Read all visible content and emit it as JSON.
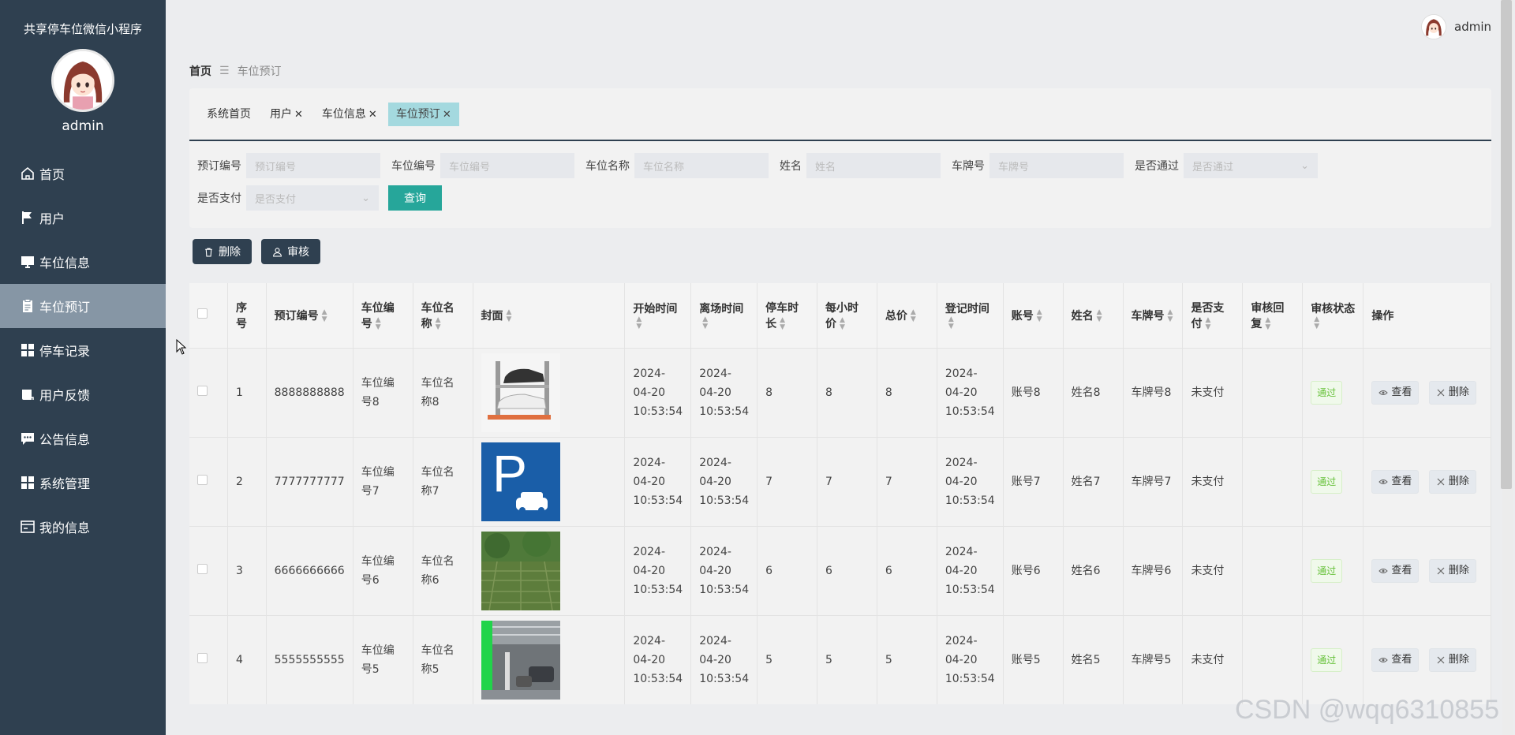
{
  "app": {
    "title": "共享停车位微信小程序",
    "user": "admin"
  },
  "sidebar": {
    "items": [
      {
        "label": "首页",
        "icon": "home-icon"
      },
      {
        "label": "用户",
        "icon": "flag-icon"
      },
      {
        "label": "车位信息",
        "icon": "monitor-icon"
      },
      {
        "label": "车位预订",
        "icon": "clipboard-icon",
        "active": true
      },
      {
        "label": "停车记录",
        "icon": "grid-icon"
      },
      {
        "label": "用户反馈",
        "icon": "book-icon"
      },
      {
        "label": "公告信息",
        "icon": "chat-icon"
      },
      {
        "label": "系统管理",
        "icon": "grid-icon"
      },
      {
        "label": "我的信息",
        "icon": "card-icon"
      }
    ]
  },
  "breadcrumb": {
    "home": "首页",
    "separator": "☰",
    "current": "车位预订"
  },
  "tabs": [
    {
      "label": "系统首页",
      "closable": false
    },
    {
      "label": "用户",
      "closable": true
    },
    {
      "label": "车位信息",
      "closable": true
    },
    {
      "label": "车位预订",
      "closable": true,
      "active": true
    }
  ],
  "search": {
    "fields": [
      {
        "label": "预订编号",
        "placeholder": "预订编号"
      },
      {
        "label": "车位编号",
        "placeholder": "车位编号"
      },
      {
        "label": "车位名称",
        "placeholder": "车位名称"
      },
      {
        "label": "姓名",
        "placeholder": "姓名"
      },
      {
        "label": "车牌号",
        "placeholder": "车牌号"
      },
      {
        "label": "是否通过",
        "placeholder": "是否通过"
      }
    ],
    "paid": {
      "label": "是否支付",
      "placeholder": "是否支付"
    },
    "query_label": "查询"
  },
  "actions": {
    "delete_label": "删除",
    "review_label": "审核"
  },
  "table": {
    "columns": [
      "序号",
      "预订编号",
      "车位编号",
      "车位名称",
      "封面",
      "开始时间",
      "离场时间",
      "停车时长",
      "每小时价",
      "总价",
      "登记时间",
      "账号",
      "姓名",
      "车牌号",
      "是否支付",
      "审核回复",
      "审核状态",
      "操作"
    ],
    "view_label": "查看",
    "delete_label": "删除",
    "rows": [
      {
        "no": "1",
        "order": "8888888888",
        "spot_no": "车位编号8",
        "spot_name": "车位名称8",
        "cover": "cover-lift",
        "start": "2024-04-20 10:53:54",
        "leave": "2024-04-20 10:53:54",
        "duration": "8",
        "price": "8",
        "total": "8",
        "reg": "2024-04-20 10:53:54",
        "account": "账号8",
        "name": "姓名8",
        "plate": "车牌号8",
        "paid": "未支付",
        "reply": "",
        "status": "通过"
      },
      {
        "no": "2",
        "order": "7777777777",
        "spot_no": "车位编号7",
        "spot_name": "车位名称7",
        "cover": "cover-sign",
        "start": "2024-04-20 10:53:54",
        "leave": "2024-04-20 10:53:54",
        "duration": "7",
        "price": "7",
        "total": "7",
        "reg": "2024-04-20 10:53:54",
        "account": "账号7",
        "name": "姓名7",
        "plate": "车牌号7",
        "paid": "未支付",
        "reply": "",
        "status": "通过"
      },
      {
        "no": "3",
        "order": "6666666666",
        "spot_no": "车位编号6",
        "spot_name": "车位名称6",
        "cover": "cover-grass",
        "start": "2024-04-20 10:53:54",
        "leave": "2024-04-20 10:53:54",
        "duration": "6",
        "price": "6",
        "total": "6",
        "reg": "2024-04-20 10:53:54",
        "account": "账号6",
        "name": "姓名6",
        "plate": "车牌号6",
        "paid": "未支付",
        "reply": "",
        "status": "通过"
      },
      {
        "no": "4",
        "order": "5555555555",
        "spot_no": "车位编号5",
        "spot_name": "车位名称5",
        "cover": "cover-garage",
        "start": "2024-04-20 10:53:54",
        "leave": "2024-04-20 10:53:54",
        "duration": "5",
        "price": "5",
        "total": "5",
        "reg": "2024-04-20 10:53:54",
        "account": "账号5",
        "name": "姓名5",
        "plate": "车牌号5",
        "paid": "未支付",
        "reply": "",
        "status": "通过"
      }
    ]
  },
  "watermark": "CSDN @wqq6310855"
}
